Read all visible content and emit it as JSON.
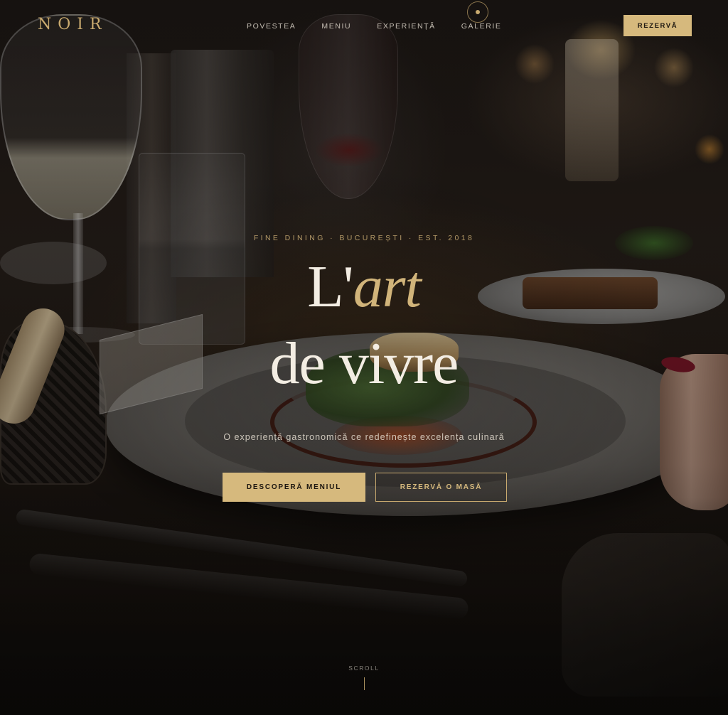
{
  "brand": {
    "logo": "NOIR"
  },
  "nav": {
    "items": [
      {
        "label": "POVESTEA"
      },
      {
        "label": "MENIU"
      },
      {
        "label": "EXPERIENȚĂ"
      },
      {
        "label": "GALERIE"
      }
    ],
    "active_indicator": "circle-dot-icon",
    "reserve_label": "REZERVĂ"
  },
  "hero": {
    "eyebrow": "FINE DINING · BUCUREȘTI · EST. 2018",
    "title_prefix": "L'",
    "title_accent": "art",
    "title_line2": "de vivre",
    "subtitle": "O experiență gastronomică ce redefinește excelența culinară",
    "cta_primary": "DESCOPERĂ MENIUL",
    "cta_secondary": "REZERVĂ O MASĂ"
  },
  "scroll": {
    "label": "SCROLL"
  },
  "colors": {
    "accent_gold": "#d6b97d",
    "text_light": "#f3ede3",
    "background": "#0c0a09"
  }
}
